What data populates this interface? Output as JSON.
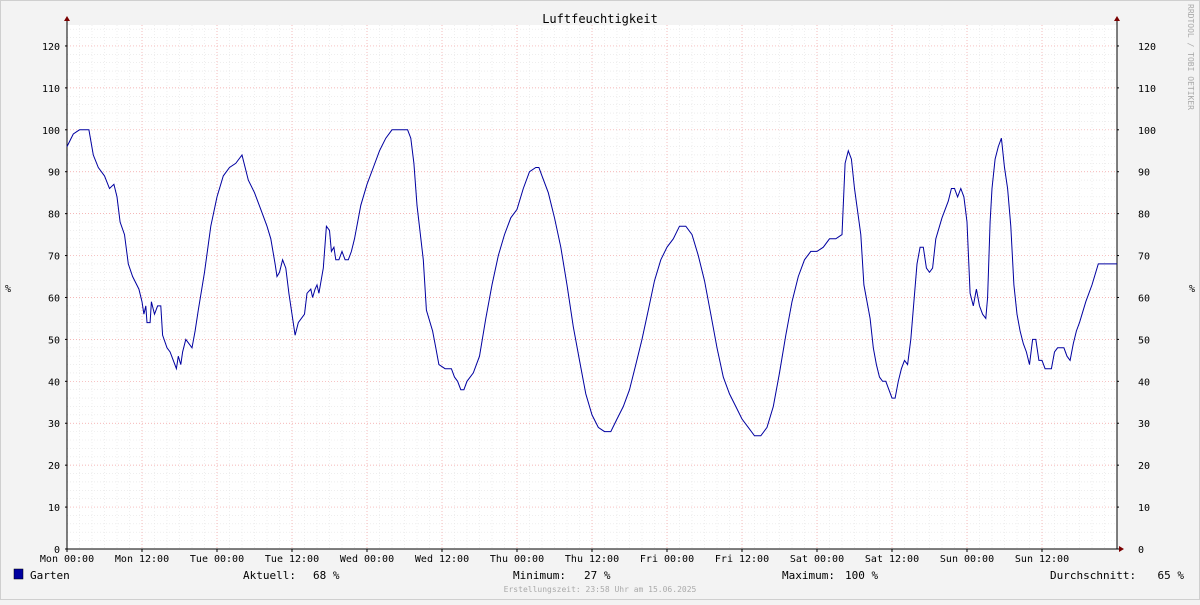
{
  "chart_data": {
    "type": "line",
    "title": "Luftfeuchtigkeit",
    "ylabel": "%",
    "ylim": [
      0,
      125
    ],
    "yticks": [
      0,
      10,
      20,
      30,
      40,
      50,
      60,
      70,
      80,
      90,
      100,
      110,
      120
    ],
    "xlim_hours": [
      0,
      168
    ],
    "xticks": [
      {
        "hour": 0,
        "label": "Mon 00:00"
      },
      {
        "hour": 12,
        "label": "Mon 12:00"
      },
      {
        "hour": 24,
        "label": "Tue 00:00"
      },
      {
        "hour": 36,
        "label": "Tue 12:00"
      },
      {
        "hour": 48,
        "label": "Wed 00:00"
      },
      {
        "hour": 60,
        "label": "Wed 12:00"
      },
      {
        "hour": 72,
        "label": "Thu 00:00"
      },
      {
        "hour": 84,
        "label": "Thu 12:00"
      },
      {
        "hour": 96,
        "label": "Fri 00:00"
      },
      {
        "hour": 108,
        "label": "Fri 12:00"
      },
      {
        "hour": 120,
        "label": "Sat 00:00"
      },
      {
        "hour": 132,
        "label": "Sat 12:00"
      },
      {
        "hour": 144,
        "label": "Sun 00:00"
      },
      {
        "hour": 156,
        "label": "Sun 12:00"
      }
    ],
    "grid": true,
    "legend_position": "bottom-left",
    "series": [
      {
        "name": "Garten",
        "color": "#0000a0",
        "points": [
          [
            0,
            96
          ],
          [
            1,
            99
          ],
          [
            2,
            100
          ],
          [
            3.5,
            100
          ],
          [
            4.2,
            94
          ],
          [
            5,
            91
          ],
          [
            6,
            89
          ],
          [
            6.8,
            86
          ],
          [
            7.5,
            87
          ],
          [
            8,
            84
          ],
          [
            8.5,
            78
          ],
          [
            9.2,
            75
          ],
          [
            9.8,
            68
          ],
          [
            10.5,
            65
          ],
          [
            11.5,
            62
          ],
          [
            12,
            59
          ],
          [
            12.3,
            56
          ],
          [
            12.6,
            58
          ],
          [
            12.8,
            54
          ],
          [
            13.3,
            54
          ],
          [
            13.5,
            59
          ],
          [
            14,
            56
          ],
          [
            14.5,
            58
          ],
          [
            15,
            58
          ],
          [
            15.3,
            51
          ],
          [
            16,
            48
          ],
          [
            16.5,
            47
          ],
          [
            17,
            45
          ],
          [
            17.5,
            43
          ],
          [
            17.8,
            46
          ],
          [
            18.2,
            44
          ],
          [
            18.5,
            47
          ],
          [
            19,
            50
          ],
          [
            20,
            48
          ],
          [
            20.5,
            52
          ],
          [
            21,
            57
          ],
          [
            22,
            66
          ],
          [
            23,
            77
          ],
          [
            24,
            84
          ],
          [
            25,
            89
          ],
          [
            26,
            91
          ],
          [
            27,
            92
          ],
          [
            28,
            94
          ],
          [
            29,
            88
          ],
          [
            30,
            85
          ],
          [
            31,
            81
          ],
          [
            32,
            77
          ],
          [
            32.6,
            74
          ],
          [
            33.3,
            68
          ],
          [
            33.6,
            65
          ],
          [
            34,
            66
          ],
          [
            34.5,
            69
          ],
          [
            35,
            67
          ],
          [
            35.5,
            61
          ],
          [
            36,
            56
          ],
          [
            36.5,
            51
          ],
          [
            37,
            54
          ],
          [
            38,
            56
          ],
          [
            38.4,
            61
          ],
          [
            39,
            62
          ],
          [
            39.3,
            60
          ],
          [
            39.7,
            62
          ],
          [
            40,
            63
          ],
          [
            40.3,
            61
          ],
          [
            41,
            67
          ],
          [
            41.5,
            77
          ],
          [
            42,
            76
          ],
          [
            42.3,
            71
          ],
          [
            42.7,
            72
          ],
          [
            43,
            69
          ],
          [
            43.5,
            69
          ],
          [
            44,
            71
          ],
          [
            44.5,
            69
          ],
          [
            45,
            69
          ],
          [
            45.5,
            71
          ],
          [
            46,
            74
          ],
          [
            47,
            82
          ],
          [
            48,
            87
          ],
          [
            49,
            91
          ],
          [
            50,
            95
          ],
          [
            51,
            98
          ],
          [
            52,
            100
          ],
          [
            54.5,
            100
          ],
          [
            55,
            98
          ],
          [
            55.5,
            92
          ],
          [
            56,
            82
          ],
          [
            57,
            69
          ],
          [
            57.5,
            57
          ],
          [
            58.5,
            52
          ],
          [
            59,
            48
          ],
          [
            59.5,
            44
          ],
          [
            60.5,
            43
          ],
          [
            61.5,
            43
          ],
          [
            62,
            41
          ],
          [
            62.5,
            40
          ],
          [
            63,
            38
          ],
          [
            63.5,
            38
          ],
          [
            64,
            40
          ],
          [
            65,
            42
          ],
          [
            66,
            46
          ],
          [
            67,
            55
          ],
          [
            68,
            63
          ],
          [
            69,
            70
          ],
          [
            70,
            75
          ],
          [
            71,
            79
          ],
          [
            72,
            81
          ],
          [
            73,
            86
          ],
          [
            74,
            90
          ],
          [
            75,
            91
          ],
          [
            75.5,
            91
          ],
          [
            76,
            89
          ],
          [
            77,
            85
          ],
          [
            78,
            79
          ],
          [
            79,
            72
          ],
          [
            80,
            63
          ],
          [
            81,
            53
          ],
          [
            82,
            45
          ],
          [
            83,
            37
          ],
          [
            84,
            32
          ],
          [
            85,
            29
          ],
          [
            86,
            28
          ],
          [
            87,
            28
          ],
          [
            88,
            31
          ],
          [
            89,
            34
          ],
          [
            90,
            38
          ],
          [
            91,
            44
          ],
          [
            92,
            50
          ],
          [
            93,
            57
          ],
          [
            94,
            64
          ],
          [
            95,
            69
          ],
          [
            96,
            72
          ],
          [
            97,
            74
          ],
          [
            98,
            77
          ],
          [
            99,
            77
          ],
          [
            100,
            75
          ],
          [
            101,
            70
          ],
          [
            102,
            64
          ],
          [
            103,
            56
          ],
          [
            104,
            48
          ],
          [
            105,
            41
          ],
          [
            106,
            37
          ],
          [
            107,
            34
          ],
          [
            108,
            31
          ],
          [
            109,
            29
          ],
          [
            110,
            27
          ],
          [
            111,
            27
          ],
          [
            112,
            29
          ],
          [
            113,
            34
          ],
          [
            114,
            42
          ],
          [
            115,
            51
          ],
          [
            116,
            59
          ],
          [
            117,
            65
          ],
          [
            118,
            69
          ],
          [
            119,
            71
          ],
          [
            120,
            71
          ],
          [
            121,
            72
          ],
          [
            122,
            74
          ],
          [
            123,
            74
          ],
          [
            124,
            75
          ],
          [
            124.5,
            92
          ],
          [
            125,
            95
          ],
          [
            125.5,
            93
          ],
          [
            126,
            86
          ],
          [
            127,
            75
          ],
          [
            127.5,
            63
          ],
          [
            128.5,
            55
          ],
          [
            129,
            48
          ],
          [
            129.5,
            44
          ],
          [
            130,
            41
          ],
          [
            130.5,
            40
          ],
          [
            131,
            40
          ],
          [
            131.5,
            38
          ],
          [
            132,
            36
          ],
          [
            132.5,
            36
          ],
          [
            133,
            40
          ],
          [
            133.5,
            43
          ],
          [
            134,
            45
          ],
          [
            134.5,
            44
          ],
          [
            135,
            50
          ],
          [
            135.5,
            59
          ],
          [
            136,
            68
          ],
          [
            136.5,
            72
          ],
          [
            137,
            72
          ],
          [
            137.5,
            67
          ],
          [
            138,
            66
          ],
          [
            138.5,
            67
          ],
          [
            139,
            74
          ],
          [
            140,
            79
          ],
          [
            141,
            83
          ],
          [
            141.5,
            86
          ],
          [
            142,
            86
          ],
          [
            142.5,
            84
          ],
          [
            143,
            86
          ],
          [
            143.5,
            84
          ],
          [
            144,
            78
          ],
          [
            144.5,
            61
          ],
          [
            145,
            58
          ],
          [
            145.5,
            62
          ],
          [
            146,
            58
          ],
          [
            146.5,
            56
          ],
          [
            147,
            55
          ],
          [
            147.3,
            60
          ],
          [
            147.7,
            78
          ],
          [
            148,
            86
          ],
          [
            148.5,
            93
          ],
          [
            149,
            96
          ],
          [
            149.5,
            98
          ],
          [
            150,
            91
          ],
          [
            150.5,
            86
          ],
          [
            151,
            77
          ],
          [
            151.5,
            63
          ],
          [
            152,
            56
          ],
          [
            152.5,
            52
          ],
          [
            153,
            49
          ],
          [
            153.5,
            47
          ],
          [
            154,
            44
          ],
          [
            154.5,
            50
          ],
          [
            155,
            50
          ],
          [
            155.5,
            45
          ],
          [
            156,
            45
          ],
          [
            156.5,
            43
          ],
          [
            157,
            43
          ],
          [
            157.5,
            43
          ],
          [
            158,
            47
          ],
          [
            158.5,
            48
          ],
          [
            159,
            48
          ],
          [
            159.5,
            48
          ],
          [
            160,
            46
          ],
          [
            160.5,
            45
          ],
          [
            161,
            49
          ],
          [
            161.5,
            52
          ],
          [
            162,
            54
          ],
          [
            163,
            59
          ],
          [
            164,
            63
          ],
          [
            165,
            68
          ],
          [
            168,
            68
          ]
        ]
      }
    ]
  },
  "legend": {
    "series_label": "Garten",
    "current_label": "Aktuell:",
    "current_value": "68 %",
    "min_label": "Minimum:",
    "min_value": "27 %",
    "max_label": "Maximum:",
    "max_value": "100 %",
    "avg_label": "Durchschnitt:",
    "avg_value": "65 %"
  },
  "footer": {
    "created": "Erstellungszeit: 23:58 Uhr am 15.06.2025"
  },
  "watermark": "RRDTOOL / TOBI OETIKER"
}
